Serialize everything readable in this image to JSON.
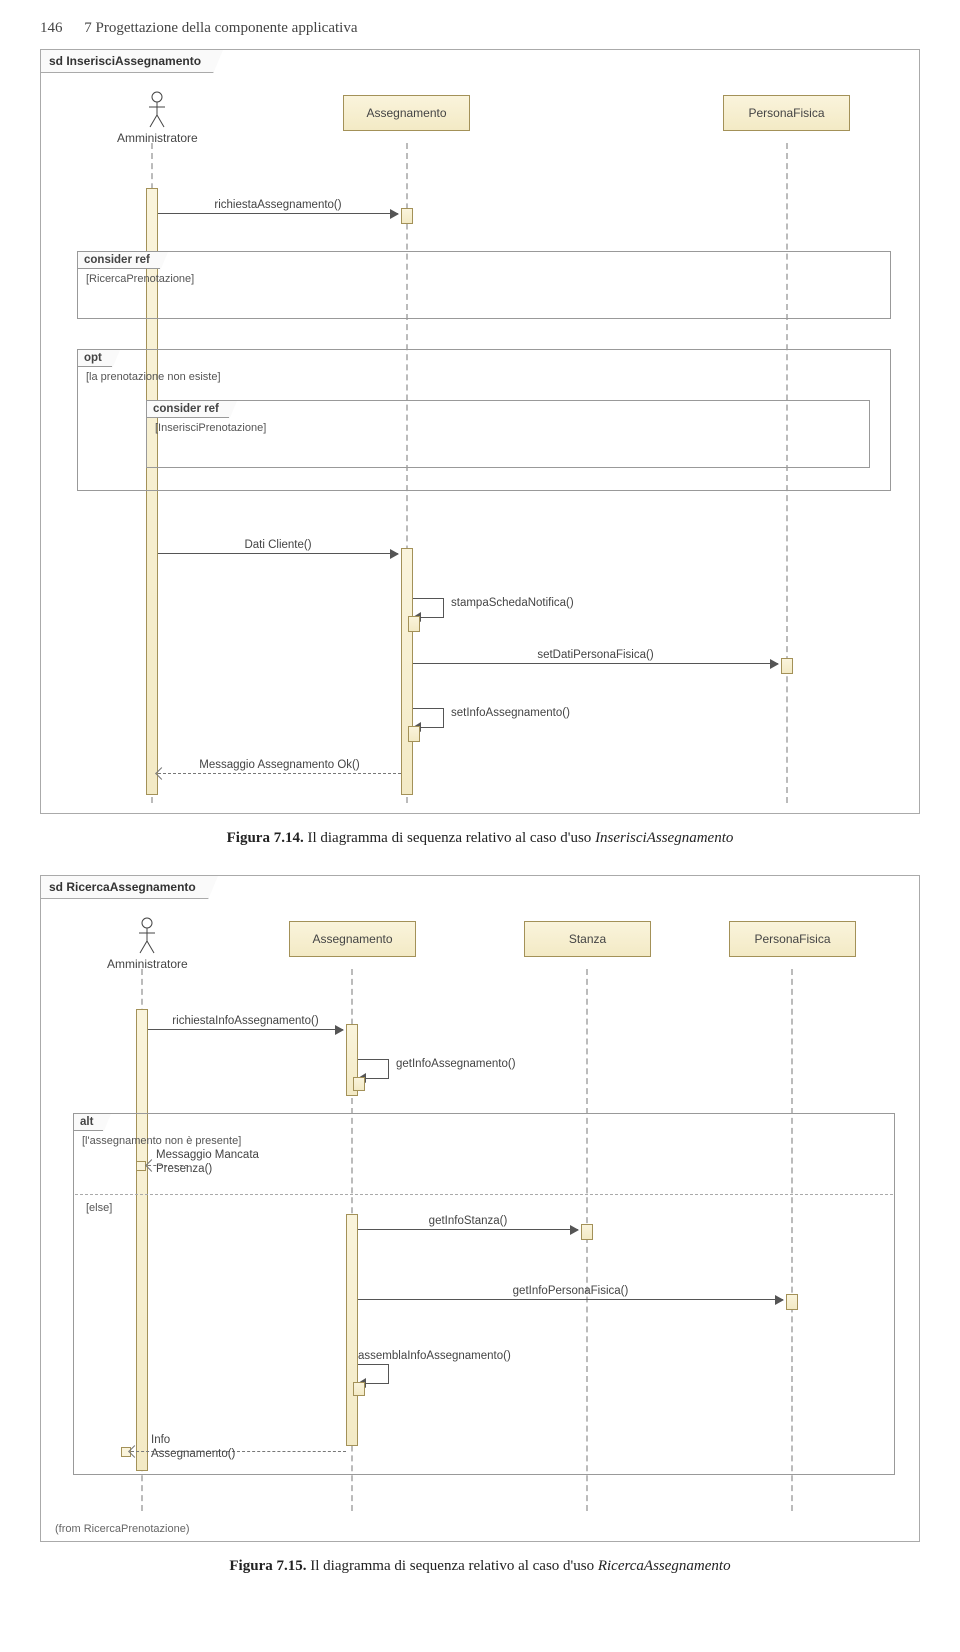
{
  "page": {
    "number": "146",
    "chapter": "7 Progettazione della componente applicativa"
  },
  "diagram1": {
    "tab": "sd InserisciAssegnamento",
    "actor": "Amministratore",
    "obj1": "Assegnamento",
    "obj2": "PersonaFisica",
    "msg1": "richiestaAssegnamento()",
    "frag1_tab": "consider ref",
    "frag1_guard": "[RicercaPrenotazione]",
    "frag2_tab": "opt",
    "frag2_guard": "[la prenotazione non esiste]",
    "frag2a_tab": "consider ref",
    "frag2a_guard": "[InserisciPrenotazione]",
    "msg2": "Dati Cliente()",
    "msg3": "stampaSchedaNotifica()",
    "msg4": "setDatiPersonaFisica()",
    "msg5": "setInfoAssegnamento()",
    "msg6": "Messaggio Assegnamento Ok()"
  },
  "caption1": {
    "bold": "Figura 7.14.",
    "text": " Il diagramma di sequenza relativo al caso d'uso ",
    "italic": "InserisciAssegnamento"
  },
  "diagram2": {
    "tab": "sd RicercaAssegnamento",
    "actor": "Amministratore",
    "obj1": "Assegnamento",
    "obj2": "Stanza",
    "obj3": "PersonaFisica",
    "msg1": "richiestaInfoAssegnamento()",
    "msg2": "getInfoAssegnamento()",
    "frag_tab": "alt",
    "frag_guard1": "[l'assegnamento non è presente]",
    "msg3a": "Messaggio Mancata",
    "msg3b": "Presenza()",
    "frag_guard2": "[else]",
    "msg4": "getInfoStanza()",
    "msg5": "getInfoPersonaFisica()",
    "msg6": "assemblaInfoAssegnamento()",
    "msg7a": "Info",
    "msg7b": "Assegnamento()",
    "footer": "(from RicercaPrenotazione)"
  },
  "caption2": {
    "bold": "Figura 7.15.",
    "text": " Il diagramma di sequenza relativo al caso d'uso ",
    "italic": "RicercaAssegnamento"
  }
}
